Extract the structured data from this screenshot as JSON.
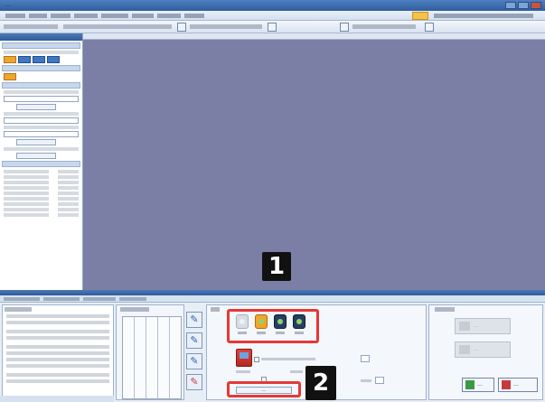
{
  "app": {
    "title": "…"
  },
  "menu": {
    "items": [
      "…",
      "…",
      "…",
      "…",
      "…",
      "…",
      "…",
      "…"
    ]
  },
  "toolbar": {
    "item_count": 14
  },
  "left_panel": {
    "header": "…",
    "sections": [
      "…",
      "…",
      "…",
      "…",
      "…",
      "…"
    ],
    "list_rows": [
      "…",
      "…",
      "…",
      "…",
      "…",
      "…",
      "…",
      "…",
      "…"
    ]
  },
  "bottom_tabs": [
    "…",
    "…",
    "…",
    "…"
  ],
  "bottom_panel": {
    "description_heading": "…",
    "slots_label": "…",
    "params_label": "…",
    "right_label": "…",
    "apply_label": "…",
    "ok_label": "…",
    "cancel_label": "…",
    "right_button_1": "…",
    "right_button_2": "…"
  },
  "tools": [
    {
      "icon": "pencil-blue-icon"
    },
    {
      "icon": "pencil-blue-icon"
    },
    {
      "icon": "pencil-blue-icon"
    },
    {
      "icon": "pencil-red-icon"
    }
  ],
  "gear_options": [
    {
      "state": "off",
      "caption": "…"
    },
    {
      "state": "selected",
      "caption": "…"
    },
    {
      "state": "normal",
      "caption": "…"
    },
    {
      "state": "normal",
      "caption": "…"
    }
  ],
  "callouts": [
    {
      "number": "1",
      "target": "gear-options-group"
    },
    {
      "number": "2",
      "target": "apply-button"
    }
  ],
  "colors": {
    "canvas": "#7b7fa6",
    "callout_border": "#e53935",
    "marker_bg": "#111111",
    "selected_gear": "#f3a52b"
  }
}
